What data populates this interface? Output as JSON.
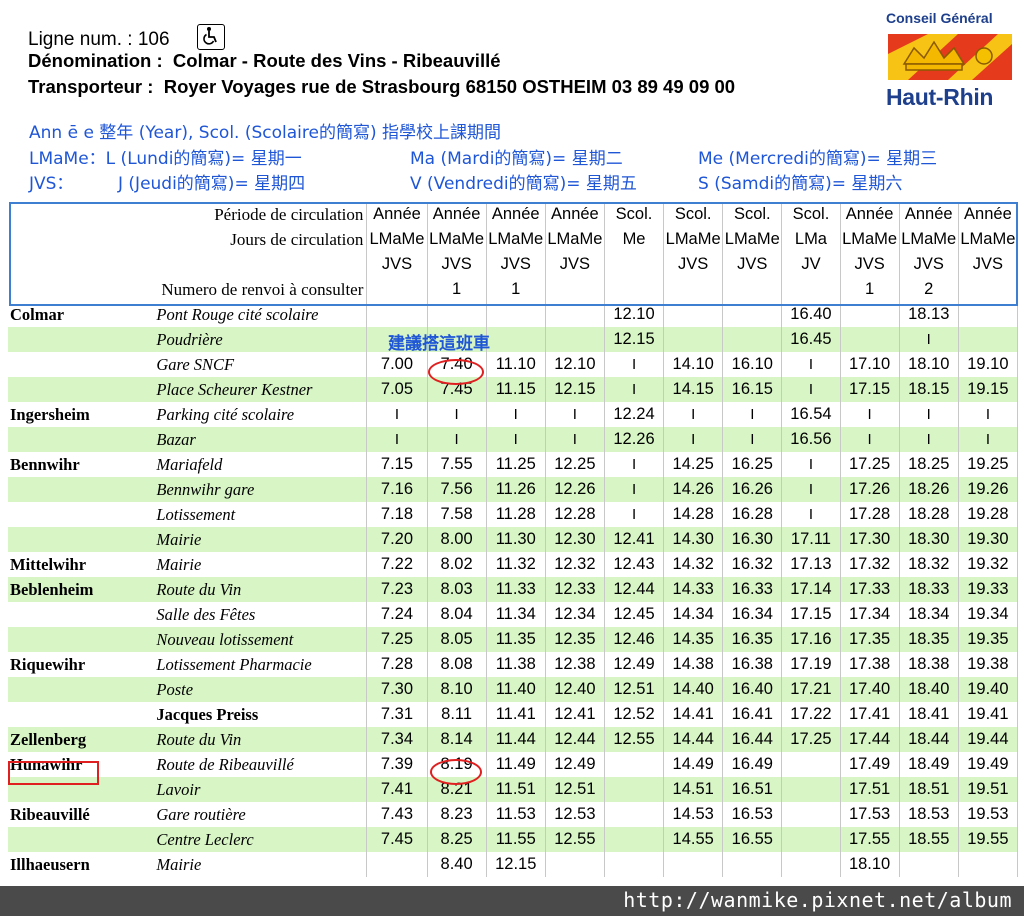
{
  "header": {
    "line_label": "Ligne num.",
    "line_number": ": 106",
    "denomination_label": "Dénomination :",
    "denomination": "Colmar - Route des Vins - Ribeauvillé",
    "transporteur_label": "Transporteur :",
    "transporteur": "Royer Voyages  rue de Strasbourg 68150 OSTHEIM 03 89 49 09 00",
    "accessibility_icon": "wheelchair-icon"
  },
  "logo": {
    "top_text": "Conseil Général",
    "bottom_text": "Haut-Rhin"
  },
  "notes": {
    "n1": "Ann ē e  整年 (Year), Scol. (Scolaire的簡寫) 指學校上課期間",
    "n2a": "LMaMe：L (Lundi的簡寫)= 星期一",
    "n2b": "Ma (Mardi的簡寫)= 星期二",
    "n2c": "Me (Mercredi的簡寫)= 星期三",
    "n3a": "JVS：",
    "n3b": "J (Jeudi的簡寫)= 星期四",
    "n3c": "V (Vendredi的簡寫)= 星期五",
    "n3d": "S (Samdi的簡寫)= 星期六"
  },
  "annotation": {
    "suggest": "建議搭這班車"
  },
  "timetable": {
    "period_label": "Période de circulation",
    "days_label": "Jours de circulation",
    "renvoi_label": "Numero de renvoi à consulter",
    "periods": [
      "Année",
      "Année",
      "Année",
      "Année",
      "Scol.",
      "Scol.",
      "Scol.",
      "Scol.",
      "Année",
      "Année",
      "Année"
    ],
    "days_top": [
      "LMaMe",
      "LMaMe",
      "LMaMe",
      "LMaMe",
      "Me",
      "LMaMe",
      "LMaMe",
      "LMa",
      "LMaMe",
      "LMaMe",
      "LMaMe"
    ],
    "days_bottom": [
      "JVS",
      "JVS",
      "JVS",
      "JVS",
      "",
      "JVS",
      "JVS",
      "JV",
      "JVS",
      "JVS",
      "JVS"
    ],
    "renvois": [
      "",
      "1",
      "1",
      "",
      "",
      "",
      "",
      "",
      "1",
      "2",
      ""
    ],
    "rows": [
      {
        "village": "Colmar",
        "stop": "Pont Rouge cité scolaire",
        "bold": false,
        "times": [
          "",
          "",
          "",
          "",
          "12.10",
          "",
          "",
          "16.40",
          "",
          "18.13",
          ""
        ]
      },
      {
        "village": "",
        "stop": "Poudrière",
        "bold": false,
        "times": [
          "",
          "",
          "",
          "",
          "12.15",
          "",
          "",
          "16.45",
          "",
          "I",
          ""
        ]
      },
      {
        "village": "",
        "stop": "Gare SNCF",
        "bold": false,
        "times": [
          "7.00",
          "7.40",
          "11.10",
          "12.10",
          "I",
          "14.10",
          "16.10",
          "I",
          "17.10",
          "18.10",
          "19.10"
        ]
      },
      {
        "village": "",
        "stop": "Place Scheurer Kestner",
        "bold": false,
        "times": [
          "7.05",
          "7.45",
          "11.15",
          "12.15",
          "I",
          "14.15",
          "16.15",
          "I",
          "17.15",
          "18.15",
          "19.15"
        ]
      },
      {
        "village": "Ingersheim",
        "stop": "Parking cité scolaire",
        "bold": false,
        "times": [
          "I",
          "I",
          "I",
          "I",
          "12.24",
          "I",
          "I",
          "16.54",
          "I",
          "I",
          "I"
        ]
      },
      {
        "village": "",
        "stop": "Bazar",
        "bold": false,
        "times": [
          "I",
          "I",
          "I",
          "I",
          "12.26",
          "I",
          "I",
          "16.56",
          "I",
          "I",
          "I"
        ]
      },
      {
        "village": "Bennwihr",
        "stop": "Mariafeld",
        "bold": false,
        "times": [
          "7.15",
          "7.55",
          "11.25",
          "12.25",
          "I",
          "14.25",
          "16.25",
          "I",
          "17.25",
          "18.25",
          "19.25"
        ]
      },
      {
        "village": "",
        "stop": "Bennwihr gare",
        "bold": false,
        "times": [
          "7.16",
          "7.56",
          "11.26",
          "12.26",
          "I",
          "14.26",
          "16.26",
          "I",
          "17.26",
          "18.26",
          "19.26"
        ]
      },
      {
        "village": "",
        "stop": "Lotissement",
        "bold": false,
        "times": [
          "7.18",
          "7.58",
          "11.28",
          "12.28",
          "I",
          "14.28",
          "16.28",
          "I",
          "17.28",
          "18.28",
          "19.28"
        ]
      },
      {
        "village": "",
        "stop": "Mairie",
        "bold": false,
        "times": [
          "7.20",
          "8.00",
          "11.30",
          "12.30",
          "12.41",
          "14.30",
          "16.30",
          "17.11",
          "17.30",
          "18.30",
          "19.30"
        ]
      },
      {
        "village": "Mittelwihr",
        "stop": "Mairie",
        "bold": false,
        "times": [
          "7.22",
          "8.02",
          "11.32",
          "12.32",
          "12.43",
          "14.32",
          "16.32",
          "17.13",
          "17.32",
          "18.32",
          "19.32"
        ]
      },
      {
        "village": "Beblenheim",
        "stop": "Route du Vin",
        "bold": false,
        "times": [
          "7.23",
          "8.03",
          "11.33",
          "12.33",
          "12.44",
          "14.33",
          "16.33",
          "17.14",
          "17.33",
          "18.33",
          "19.33"
        ]
      },
      {
        "village": "",
        "stop": "Salle des Fêtes",
        "bold": false,
        "times": [
          "7.24",
          "8.04",
          "11.34",
          "12.34",
          "12.45",
          "14.34",
          "16.34",
          "17.15",
          "17.34",
          "18.34",
          "19.34"
        ]
      },
      {
        "village": "",
        "stop": "Nouveau lotissement",
        "bold": false,
        "times": [
          "7.25",
          "8.05",
          "11.35",
          "12.35",
          "12.46",
          "14.35",
          "16.35",
          "17.16",
          "17.35",
          "18.35",
          "19.35"
        ]
      },
      {
        "village": "Riquewihr",
        "stop": "Lotissement Pharmacie",
        "bold": false,
        "times": [
          "7.28",
          "8.08",
          "11.38",
          "12.38",
          "12.49",
          "14.38",
          "16.38",
          "17.19",
          "17.38",
          "18.38",
          "19.38"
        ]
      },
      {
        "village": "",
        "stop": "Poste",
        "bold": false,
        "times": [
          "7.30",
          "8.10",
          "11.40",
          "12.40",
          "12.51",
          "14.40",
          "16.40",
          "17.21",
          "17.40",
          "18.40",
          "19.40"
        ]
      },
      {
        "village": "",
        "stop": "Jacques Preiss",
        "bold": true,
        "times": [
          "7.31",
          "8.11",
          "11.41",
          "12.41",
          "12.52",
          "14.41",
          "16.41",
          "17.22",
          "17.41",
          "18.41",
          "19.41"
        ]
      },
      {
        "village": "Zellenberg",
        "stop": "Route du Vin",
        "bold": false,
        "times": [
          "7.34",
          "8.14",
          "11.44",
          "12.44",
          "12.55",
          "14.44",
          "16.44",
          "17.25",
          "17.44",
          "18.44",
          "19.44"
        ]
      },
      {
        "village": "Hunawihr",
        "stop": "Route de Ribeauvillé",
        "bold": false,
        "times": [
          "7.39",
          "8.19",
          "11.49",
          "12.49",
          "",
          "14.49",
          "16.49",
          "",
          "17.49",
          "18.49",
          "19.49"
        ]
      },
      {
        "village": "",
        "stop": "Lavoir",
        "bold": false,
        "times": [
          "7.41",
          "8.21",
          "11.51",
          "12.51",
          "",
          "14.51",
          "16.51",
          "",
          "17.51",
          "18.51",
          "19.51"
        ]
      },
      {
        "village": "Ribeauvillé",
        "stop": "Gare routière",
        "bold": false,
        "times": [
          "7.43",
          "8.23",
          "11.53",
          "12.53",
          "",
          "14.53",
          "16.53",
          "",
          "17.53",
          "18.53",
          "19.53"
        ]
      },
      {
        "village": "",
        "stop": "Centre Leclerc",
        "bold": false,
        "times": [
          "7.45",
          "8.25",
          "11.55",
          "12.55",
          "",
          "14.55",
          "16.55",
          "",
          "17.55",
          "18.55",
          "19.55"
        ]
      },
      {
        "village": "Illhaeusern",
        "stop": "Mairie",
        "bold": false,
        "times": [
          "",
          "8.40",
          "12.15",
          "",
          "",
          "",
          "",
          "",
          "18.10",
          "",
          ""
        ]
      }
    ]
  },
  "watermark": "http://wanmike.pixnet.net/album",
  "colors": {
    "row_green": "#d8f5c6",
    "note_blue": "#1f56d6",
    "frame_blue": "#3f7fd1",
    "highlight_red": "#e02020",
    "logo_blue": "#1d3f8c"
  }
}
